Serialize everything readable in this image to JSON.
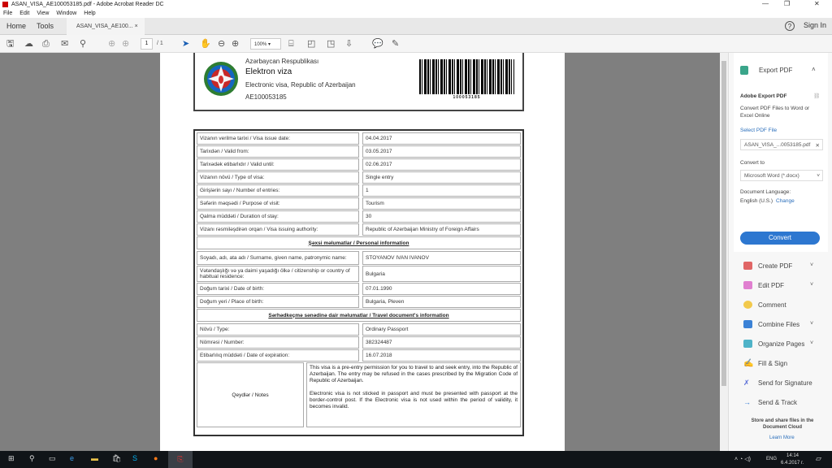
{
  "window": {
    "title": "ASAN_VISA_AE100053185.pdf - Adobe Acrobat Reader DC"
  },
  "menu": [
    "File",
    "Edit",
    "View",
    "Window",
    "Help"
  ],
  "tabs": {
    "home": "Home",
    "tools": "Tools",
    "doc": "ASAN_VISA_AE100...",
    "help": "?",
    "signin": "Sign In"
  },
  "toolbar": {
    "page_current": "1",
    "page_total": "/ 1",
    "zoom": "100%"
  },
  "doc": {
    "header": {
      "line1": "Azərbaycan Respublikası",
      "line2": "Elektron viza",
      "line3": "Electronic visa, Republic of Azerbaijan",
      "number": "AE100053185",
      "barcode": "100053185"
    },
    "visa_rows": [
      {
        "label": "Vizanın verilmə tarixi / Visa issue date:",
        "value": "04.04.2017"
      },
      {
        "label": "Tarixdən / Valid from:",
        "value": "03.05.2017"
      },
      {
        "label": "Tarixədək etibarlıdır / Valid until:",
        "value": "02.06.2017"
      },
      {
        "label": "Vizanın növü / Type of visa:",
        "value": "Single entry"
      },
      {
        "label": "Girişlərin sayı / Number of entries:",
        "value": "1"
      },
      {
        "label": "Səfərin məqsədi / Purpose of visit:",
        "value": "Tourism"
      },
      {
        "label": "Qalma müddəti / Duration of stay:",
        "value": "30"
      },
      {
        "label": "Vizanı rəsmiləşdirən orqan / Visa issuing authority:",
        "value": "Republic of Azerbaijan Ministry of Foreign Affairs"
      }
    ],
    "personal_title": "Şəxsi məlumatlar / Personal information",
    "personal_rows": [
      {
        "label": "Soyadı, adı, ata adı / Surname, given name, patronymic name:",
        "value": "STOYANOV IVAN IVANOV"
      },
      {
        "label": "Vətəndaşlığı və ya daimi yaşadığı ölkə / citizenship or country of habitual residence:",
        "value": "Bulgaria"
      },
      {
        "label": "Doğum tarixi / Date of birth:",
        "value": "07.01.1990"
      },
      {
        "label": "Doğum yeri / Place of birth:",
        "value": "Bulgaria, Pleven"
      }
    ],
    "travel_title": "Sərhədkeçmə sənədinə dair məlumatlar / Travel document's information",
    "travel_rows": [
      {
        "label": "Növü / Type:",
        "value": "Ordinary Passport"
      },
      {
        "label": "Nömrəsi / Number:",
        "value": "382324487"
      },
      {
        "label": "Etibarlılıq müddəti / Date of expiration:",
        "value": "16.07.2018"
      }
    ],
    "notes_label": "Qeydlər / Notes",
    "notes_p1": "This visa is a pre-entry permission for you to travel to and seek entry, into the Republic of Azerbaijan. The entry may be refused in the cases prescribed by the Migration Code of Republic of Azerbaijan.",
    "notes_p2": "Electronic visa is not sticked in passport and must be presented with passport at the border-control post. If the Electronic visa is not used within the period of validity, it becomes invalid."
  },
  "panel": {
    "export_title": "Export PDF",
    "service": "Adobe Export PDF",
    "desc": "Convert PDF Files to Word or Excel Online",
    "select_file": "Select PDF File",
    "file": "ASAN_VISA_...0053185.pdf",
    "convert_to": "Convert to",
    "format": "Microsoft Word (*.docx)",
    "lang_label": "Document Language:",
    "lang": "English (U.S.)",
    "change": "Change",
    "convert": "Convert",
    "tools": [
      "Create PDF",
      "Edit PDF",
      "Comment",
      "Combine Files",
      "Organize Pages",
      "Fill & Sign",
      "Send for Signature",
      "Send & Track"
    ],
    "cloud": "Store and share files in the Document Cloud",
    "learn": "Learn More",
    "colors": {
      "accent": "#2d77d0"
    }
  },
  "taskbar": {
    "lang": "ENG",
    "time": "14:14",
    "date": "6.4.2017 г."
  }
}
